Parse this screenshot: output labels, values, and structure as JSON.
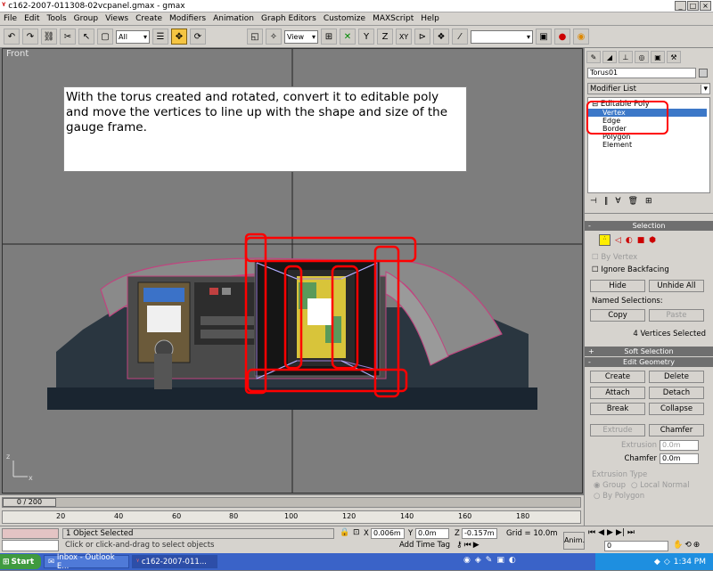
{
  "window": {
    "title": "c162-2007-011308-02vcpanel.gmax - gmax",
    "btn_min": "_",
    "btn_max": "□",
    "btn_close": "×"
  },
  "menu": [
    "File",
    "Edit",
    "Tools",
    "Group",
    "Views",
    "Create",
    "Modifiers",
    "Animation",
    "Graph Editors",
    "Customize",
    "MAXScript",
    "Help"
  ],
  "toolbar": {
    "filter_value": "All",
    "refcoord_value": "View",
    "named_sel_value": ""
  },
  "viewport": {
    "label": "Front"
  },
  "caption": {
    "text": "With the torus created and rotated, convert it to editable poly and move the vertices to line up with the shape and size of the gauge frame."
  },
  "cmdpanel": {
    "object_name": "Torus01",
    "modifier_list": "Modifier List",
    "stack": {
      "root": "Editable Poly",
      "items": [
        "Vertex",
        "Edge",
        "Border",
        "Polygon",
        "Element"
      ],
      "selected": "Vertex"
    },
    "selection": {
      "title": "Selection",
      "by_vertex": "By Vertex",
      "ignore_backfacing": "Ignore Backfacing",
      "hide": "Hide",
      "unhide_all": "Unhide All",
      "named_selections": "Named Selections:",
      "copy": "Copy",
      "paste": "Paste",
      "status": "4 Vertices Selected"
    },
    "soft_selection": {
      "title": "Soft Selection"
    },
    "edit_geometry": {
      "title": "Edit Geometry",
      "create": "Create",
      "delete": "Delete",
      "attach": "Attach",
      "detach": "Detach",
      "break": "Break",
      "collapse": "Collapse",
      "extrude": "Extrude",
      "chamfer_btn": "Chamfer",
      "extrusion_label": "Extrusion",
      "extrusion_value": "0.0m",
      "chamfer_label": "Chamfer",
      "chamfer_value": "0.0m",
      "extrusion_type": "Extrusion Type",
      "group": "Group",
      "local_normal": "Local Normal",
      "by_polygon": "By Polygon"
    }
  },
  "timeline": {
    "frame": "0 / 200",
    "ticks": [
      "20",
      "40",
      "60",
      "80",
      "100",
      "120",
      "140",
      "160",
      "180"
    ]
  },
  "status": {
    "objects": "1 Object Selected",
    "prompt": "Click or click-and-drag to select objects",
    "x_label": "X",
    "x_value": "0.006m",
    "y_label": "Y",
    "y_value": "0.0m",
    "z_label": "Z",
    "z_value": "-0.157m",
    "grid": "Grid = 10.0m",
    "add_time_tag": "Add Time Tag",
    "anim": "Anim.",
    "frame_field": "0"
  },
  "taskbar": {
    "start": "Start",
    "tasks": [
      "Inbox - Outlook E...",
      "c162-2007-011..."
    ],
    "clock": "1:34 PM"
  },
  "colors": {
    "highlight": "#ff0000",
    "selection_blue": "#3c78c8",
    "vertex_yellow": "#ffee00"
  }
}
